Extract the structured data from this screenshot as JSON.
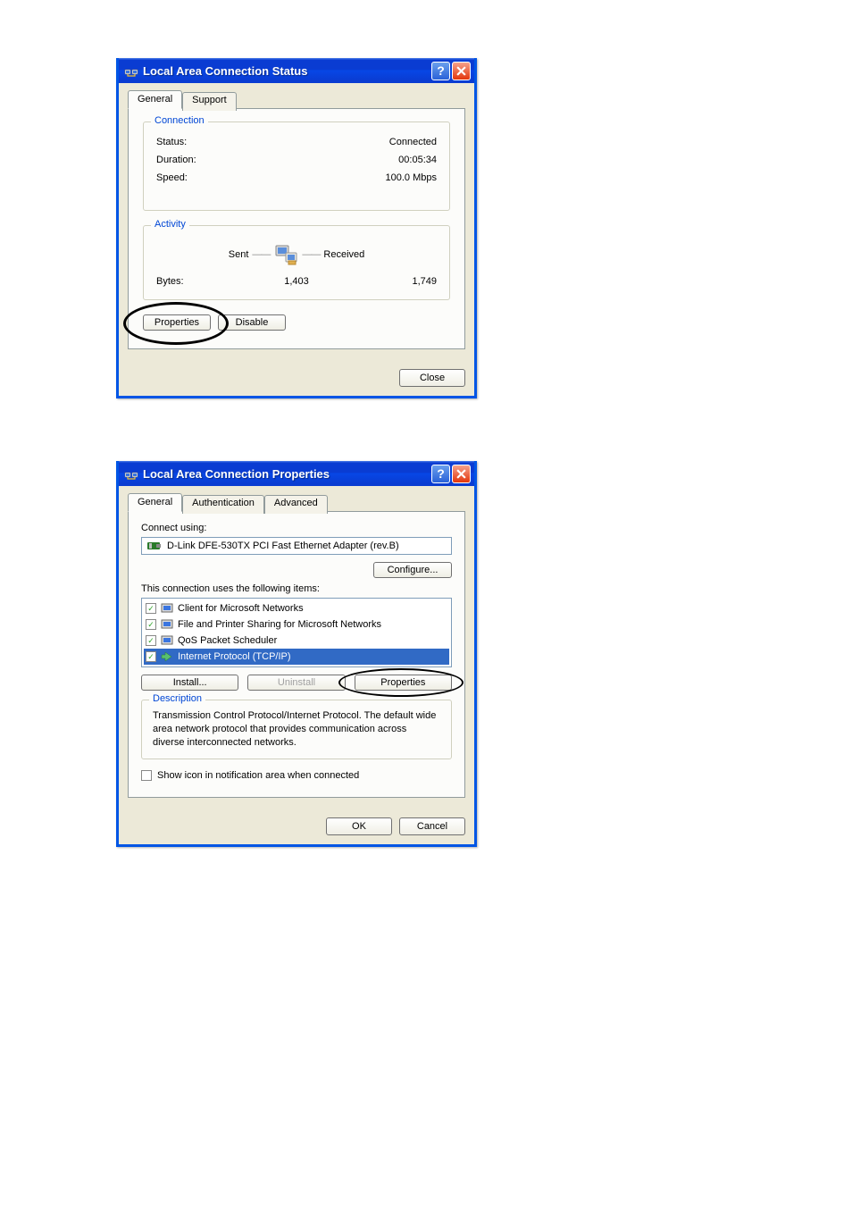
{
  "dialog1": {
    "title": "Local Area Connection Status",
    "tabs": {
      "general": "General",
      "support": "Support"
    },
    "connection": {
      "legend": "Connection",
      "status_label": "Status:",
      "status_value": "Connected",
      "duration_label": "Duration:",
      "duration_value": "00:05:34",
      "speed_label": "Speed:",
      "speed_value": "100.0 Mbps"
    },
    "activity": {
      "legend": "Activity",
      "sent_label": "Sent",
      "received_label": "Received",
      "bytes_label": "Bytes:",
      "sent_value": "1,403",
      "received_value": "1,749"
    },
    "buttons": {
      "properties": "Properties",
      "disable": "Disable",
      "close": "Close"
    }
  },
  "dialog2": {
    "title": "Local Area Connection Properties",
    "tabs": {
      "general": "General",
      "authentication": "Authentication",
      "advanced": "Advanced"
    },
    "connect_using_label": "Connect using:",
    "adapter": "D-Link DFE-530TX PCI Fast Ethernet Adapter (rev.B)",
    "configure": "Configure...",
    "items_label": "This connection uses the following items:",
    "items": [
      {
        "label": "Client for Microsoft Networks",
        "selected": false
      },
      {
        "label": "File and Printer Sharing for Microsoft Networks",
        "selected": false
      },
      {
        "label": "QoS Packet Scheduler",
        "selected": false
      },
      {
        "label": "Internet Protocol (TCP/IP)",
        "selected": true
      }
    ],
    "install": "Install...",
    "uninstall": "Uninstall",
    "properties": "Properties",
    "description_legend": "Description",
    "description": "Transmission Control Protocol/Internet Protocol. The default wide area network protocol that provides communication across diverse interconnected networks.",
    "show_icon": "Show icon in notification area when connected",
    "ok": "OK",
    "cancel": "Cancel"
  }
}
